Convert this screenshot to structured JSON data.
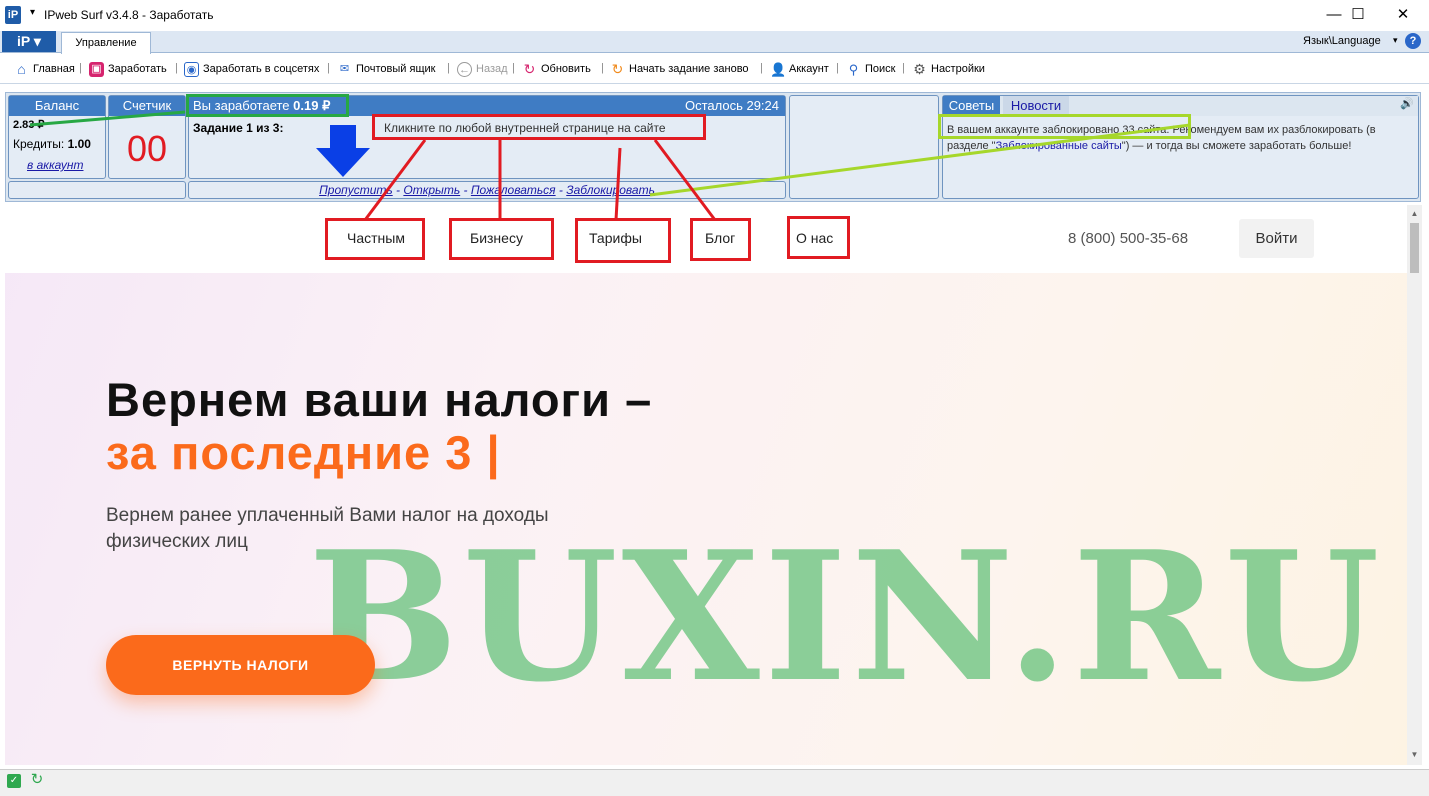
{
  "window": {
    "title": "IPweb Surf v3.4.8 - Заработать",
    "app_logo": "iP",
    "pin_glyph": "▾",
    "minimize": "—",
    "maximize": "☐",
    "close": "✕"
  },
  "tabs": {
    "ip_menu": "iP ▾",
    "active": "Управление",
    "language": "Язык\\Language",
    "help": "?"
  },
  "toolbar": [
    {
      "label": "Главная",
      "icon": "home-icon"
    },
    {
      "label": "Заработать",
      "icon": "wallet-icon"
    },
    {
      "label": "Заработать в соцсетях",
      "icon": "social-icon"
    },
    {
      "label": "Почтовый ящик",
      "icon": "mail-icon"
    },
    {
      "label": "Назад",
      "icon": "back-icon",
      "disabled": true
    },
    {
      "label": "Обновить",
      "icon": "refresh-icon"
    },
    {
      "label": "Начать задание заново",
      "icon": "restart-icon"
    },
    {
      "label": "Аккаунт",
      "icon": "user-icon"
    },
    {
      "label": "Поиск",
      "icon": "search-icon"
    },
    {
      "label": "Настройки",
      "icon": "gear-icon"
    }
  ],
  "panel": {
    "balance_title": "Баланс",
    "balance_value": "2.83 ₽",
    "credits_label": "Кредиты:",
    "credits_value": "1.00",
    "to_account": "в аккаунт",
    "counter_title": "Счетчик",
    "counter_value": "00",
    "earn_prefix": "Вы заработаете",
    "earn_value": "0.19 ₽",
    "time_left": "Осталось 29:24",
    "task_label": "Задание 1 из 3:",
    "task_text": "Кликните по любой внутренней странице на сайте",
    "actions": [
      "Пропустить",
      "Открыть",
      "Пожаловаться",
      "Заблокировать"
    ],
    "action_sep": " - ",
    "tips_tab": "Советы",
    "news_tab": "Новости",
    "tip_text_1": "В вашем аккаунте заблокировано 33 сайта.",
    "tip_text_2": " Рекомендуем вам их разблокировать (в разделе \"",
    "tip_link": "Заблокированные сайты",
    "tip_text_3": "\") — и тогда вы сможете заработать больше!",
    "sound_icon": "🔊"
  },
  "site": {
    "nav": [
      "Частным",
      "Бизнесу",
      "Тарифы",
      "Блог",
      "О нас"
    ],
    "phone": "8 (800) 500-35-68",
    "login": "Войти",
    "headline_1": "Вернем ваши налоги –",
    "headline_2": "за последние 3 |",
    "sub_1": "Вернем ранее уплаченный Вами налог на доходы",
    "sub_2": "физических лиц",
    "cta": "ВЕРНУТЬ НАЛОГИ"
  },
  "watermark": "BUXIN.RU",
  "colors": {
    "accent": "#3f7cc4",
    "orange": "#fb6a1b",
    "annotation_red": "#e11b22",
    "annotation_green": "#27a844",
    "annotation_lime": "#a6d72b",
    "arrow_blue": "#0a3fe6",
    "watermark": "#5cbf73"
  }
}
